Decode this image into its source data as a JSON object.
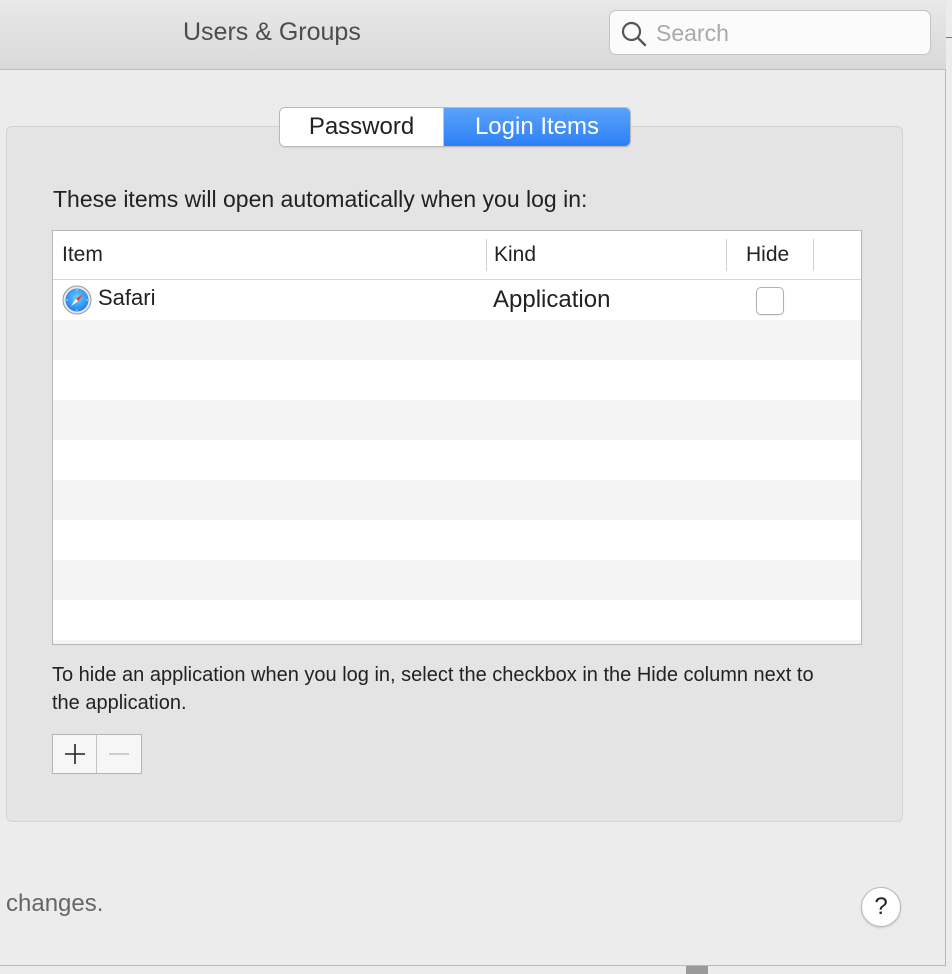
{
  "window": {
    "title": "Users & Groups"
  },
  "search": {
    "placeholder": "Search",
    "value": ""
  },
  "tabs": [
    {
      "label": "Password",
      "selected": false
    },
    {
      "label": "Login Items",
      "selected": true
    }
  ],
  "login_items": {
    "intro": "These items will open automatically when you log in:",
    "columns": {
      "item": "Item",
      "kind": "Kind",
      "hide": "Hide"
    },
    "rows": [
      {
        "icon": "safari-icon",
        "name": "Safari",
        "kind": "Application",
        "hide": false
      }
    ],
    "help_text": "To hide an application when you log in, select the checkbox in the Hide column next to the application."
  },
  "footer": {
    "changes_text": "changes.",
    "help_button_label": "?"
  },
  "colors": {
    "accent": "#2d7ff6",
    "background": "#ececec"
  }
}
